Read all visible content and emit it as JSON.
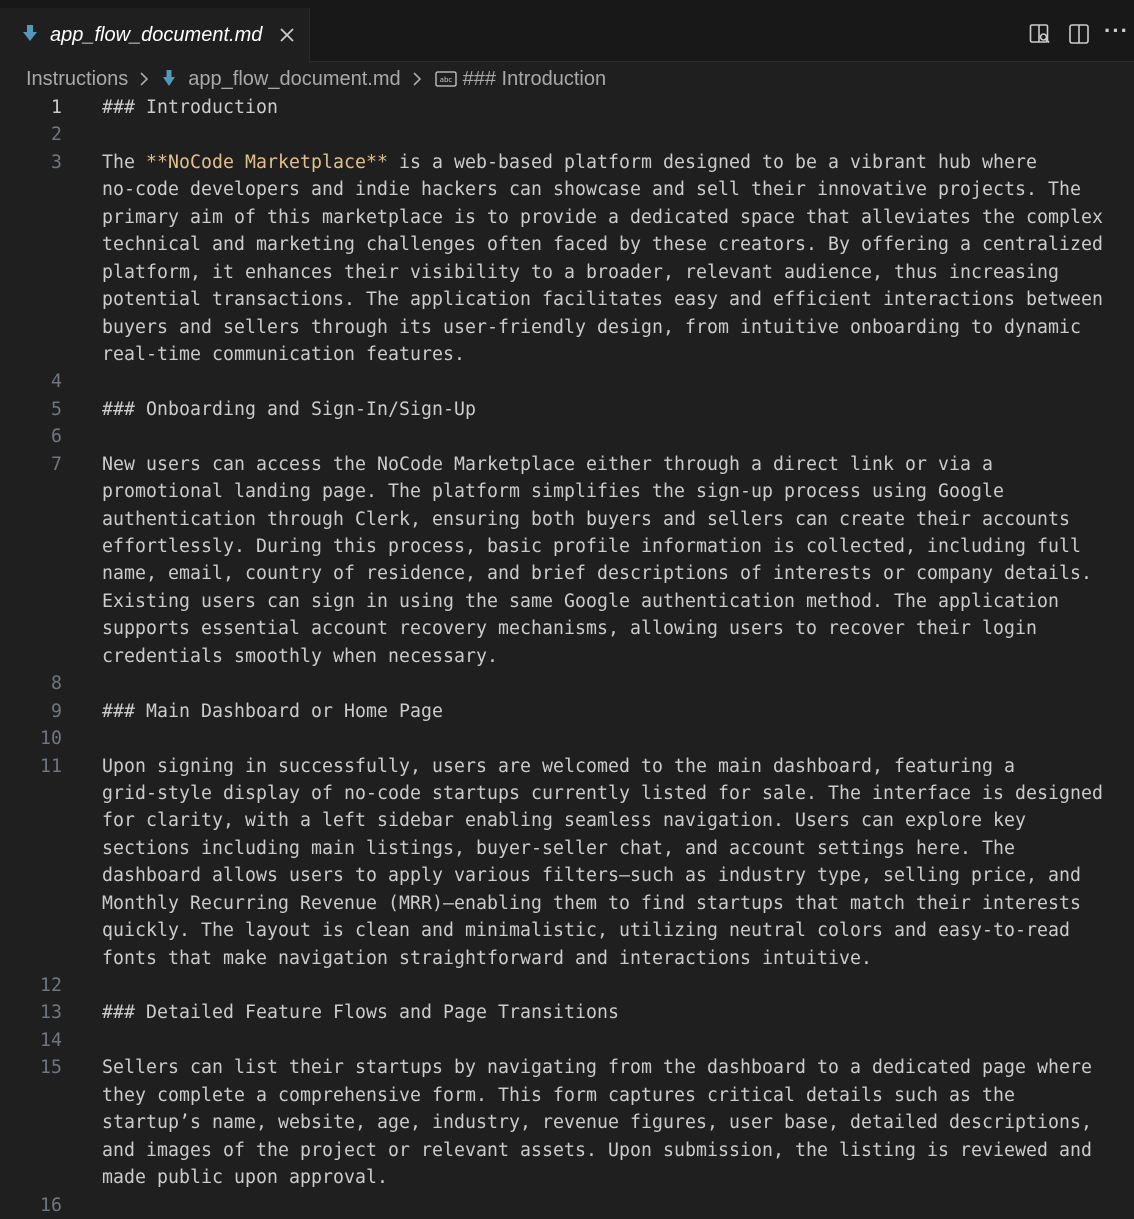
{
  "tab": {
    "icon": "markdown-down-arrow-icon",
    "label": "app_flow_document.md"
  },
  "toolbar": {
    "icons": [
      "open-preview-icon",
      "split-editor-icon",
      "more-actions-icon"
    ],
    "more_label": "···"
  },
  "breadcrumb": {
    "folder": "Instructions",
    "file": "app_flow_document.md",
    "symbol": "### Introduction"
  },
  "editor": {
    "active_line": 1,
    "lines": [
      {
        "n": "1",
        "wrapped": [
          "### Introduction"
        ]
      },
      {
        "n": "2",
        "wrapped": [
          ""
        ]
      },
      {
        "n": "3",
        "bold": "**NoCode Marketplace**",
        "pre": "The ",
        "wrapped": [
          " is a web-based platform designed to be a vibrant hub where",
          "no-code developers and indie hackers can showcase and sell their innovative projects. The",
          "primary aim of this marketplace is to provide a dedicated space that alleviates the complex",
          "technical and marketing challenges often faced by these creators. By offering a centralized",
          "platform, it enhances their visibility to a broader, relevant audience, thus increasing",
          "potential transactions. The application facilitates easy and efficient interactions between",
          "buyers and sellers through its user-friendly design, from intuitive onboarding to dynamic",
          "real-time communication features."
        ]
      },
      {
        "n": "4",
        "wrapped": [
          ""
        ]
      },
      {
        "n": "5",
        "wrapped": [
          "### Onboarding and Sign-In/Sign-Up"
        ]
      },
      {
        "n": "6",
        "wrapped": [
          ""
        ]
      },
      {
        "n": "7",
        "wrapped": [
          "New users can access the NoCode Marketplace either through a direct link or via a",
          "promotional landing page. The platform simplifies the sign-up process using Google",
          "authentication through Clerk, ensuring both buyers and sellers can create their accounts",
          "effortlessly. During this process, basic profile information is collected, including full",
          "name, email, country of residence, and brief descriptions of interests or company details.",
          "Existing users can sign in using the same Google authentication method. The application",
          "supports essential account recovery mechanisms, allowing users to recover their login",
          "credentials smoothly when necessary."
        ]
      },
      {
        "n": "8",
        "wrapped": [
          ""
        ]
      },
      {
        "n": "9",
        "wrapped": [
          "### Main Dashboard or Home Page"
        ]
      },
      {
        "n": "10",
        "wrapped": [
          ""
        ]
      },
      {
        "n": "11",
        "wrapped": [
          "Upon signing in successfully, users are welcomed to the main dashboard, featuring a",
          "grid-style display of no-code startups currently listed for sale. The interface is designed",
          "for clarity, with a left sidebar enabling seamless navigation. Users can explore key",
          "sections including main listings, buyer-seller chat, and account settings here. The",
          "dashboard allows users to apply various filters—such as industry type, selling price, and",
          "Monthly Recurring Revenue (MRR)—enabling them to find startups that match their interests",
          "quickly. The layout is clean and minimalistic, utilizing neutral colors and easy-to-read",
          "fonts that make navigation straightforward and interactions intuitive."
        ]
      },
      {
        "n": "12",
        "wrapped": [
          ""
        ]
      },
      {
        "n": "13",
        "wrapped": [
          "### Detailed Feature Flows and Page Transitions"
        ]
      },
      {
        "n": "14",
        "wrapped": [
          ""
        ]
      },
      {
        "n": "15",
        "wrapped": [
          "Sellers can list their startups by navigating from the dashboard to a dedicated page where",
          "they complete a comprehensive form. This form captures critical details such as the",
          "startup’s name, website, age, industry, revenue figures, user base, detailed descriptions,",
          "and images of the project or relevant assets. Upon submission, the listing is reviewed and",
          "made public upon approval."
        ]
      },
      {
        "n": "16",
        "wrapped": [
          ""
        ]
      }
    ]
  },
  "colors": {
    "background": "#1f1f1f",
    "tabbar": "#181818",
    "text": "#cccccc",
    "line_number": "#6e7681",
    "bold_markup": "#e2c08d",
    "markdown_icon": "#519aba"
  }
}
